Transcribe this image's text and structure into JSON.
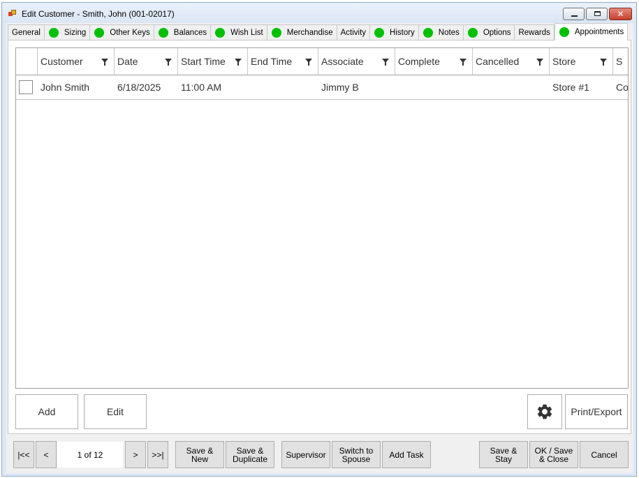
{
  "window": {
    "title": "Edit Customer - Smith, John (001-02017)",
    "controls": [
      "minimize",
      "maximize",
      "close"
    ]
  },
  "tabs": [
    {
      "label": "General",
      "dot": false,
      "active": false
    },
    {
      "label": "Sizing",
      "dot": true,
      "active": false
    },
    {
      "label": "Other Keys",
      "dot": true,
      "active": false
    },
    {
      "label": "Balances",
      "dot": true,
      "active": false
    },
    {
      "label": "Wish List",
      "dot": true,
      "active": false
    },
    {
      "label": "Merchandise",
      "dot": true,
      "active": false
    },
    {
      "label": "Activity",
      "dot": false,
      "active": false
    },
    {
      "label": "History",
      "dot": true,
      "active": false
    },
    {
      "label": "Notes",
      "dot": true,
      "active": false
    },
    {
      "label": "Options",
      "dot": true,
      "active": false
    },
    {
      "label": "Rewards",
      "dot": false,
      "active": false
    },
    {
      "label": "Appointments",
      "dot": true,
      "active": true
    }
  ],
  "grid": {
    "columns": [
      "Customer",
      "Date",
      "Start Time",
      "End Time",
      "Associate",
      "Complete",
      "Cancelled",
      "Store",
      "S"
    ],
    "rows": [
      {
        "customer": "John Smith",
        "date": "6/18/2025",
        "start_time": "11:00 AM",
        "end_time": "",
        "associate": "Jimmy B",
        "complete": "",
        "cancelled": "",
        "store": "Store #1",
        "s": "Co"
      }
    ]
  },
  "panel_buttons": {
    "add": "Add",
    "edit": "Edit",
    "settings_icon": "gear-icon",
    "print_export": "Print/Export"
  },
  "pager": {
    "first": "|<<",
    "prev": "<",
    "position": "1 of 12",
    "next": ">",
    "last": ">>|"
  },
  "footer_buttons": {
    "save_new": [
      "Save &",
      "New"
    ],
    "save_duplicate": [
      "Save &",
      "Duplicate"
    ],
    "supervisor": "Supervisor",
    "switch_spouse": [
      "Switch to",
      "Spouse"
    ],
    "add_task": "Add Task",
    "save_stay": [
      "Save &",
      "Stay"
    ],
    "ok_save_close": [
      "OK / Save",
      "& Close"
    ],
    "cancel": "Cancel"
  },
  "colors": {
    "status_dot": "#00c000",
    "accent_border": "#8ea7c4"
  }
}
